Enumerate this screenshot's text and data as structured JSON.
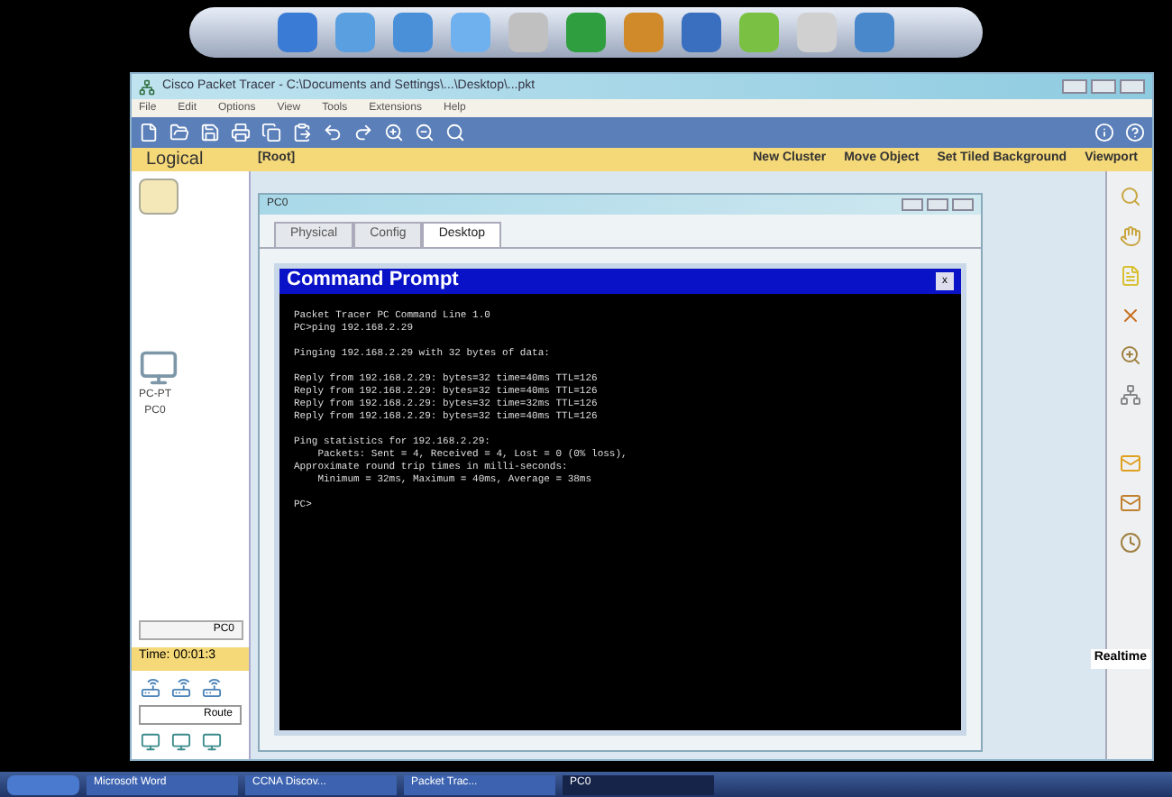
{
  "window": {
    "title": "Cisco Packet Tracer - C:\\Documents and Settings\\...\\Desktop\\...pkt"
  },
  "menu": [
    "File",
    "Edit",
    "Options",
    "View",
    "Tools",
    "Extensions",
    "Help"
  ],
  "workspace_bar": {
    "mode": "Logical",
    "path": "[Root]",
    "actions": [
      "New Cluster",
      "Move Object",
      "Set Tiled Background",
      "Viewport"
    ]
  },
  "devices": [
    {
      "label": "PC-PT\nPC0"
    }
  ],
  "device_name_field": {
    "value": "PC0"
  },
  "time": "Time: 00:01:3",
  "device_category": "Route",
  "realtime": {
    "label": "Realtime"
  },
  "pc_window": {
    "title": "PC0",
    "tabs": [
      {
        "label": "Physical",
        "selected": false
      },
      {
        "label": "Config",
        "selected": false
      },
      {
        "label": "Desktop",
        "selected": true
      }
    ]
  },
  "command_prompt": {
    "title": "Command Prompt",
    "close": "x",
    "blocks": [
      [
        "Packet Tracer PC Command Line 1.0",
        "PC>ping 192.168.2.29"
      ],
      [
        "Pinging 192.168.2.29 with 32 bytes of data:"
      ],
      [
        "Reply from 192.168.2.29: bytes=32 time=40ms TTL=126",
        "Reply from 192.168.2.29: bytes=32 time=40ms TTL=126",
        "Reply from 192.168.2.29: bytes=32 time=32ms TTL=126",
        "Reply from 192.168.2.29: bytes=32 time=40ms TTL=126"
      ],
      [
        "Ping statistics for 192.168.2.29:",
        "    Packets: Sent = 4, Received = 4, Lost = 0 (0% loss),",
        "Approximate round trip times in milli-seconds:",
        "    Minimum = 32ms, Maximum = 40ms, Average = 38ms"
      ],
      [
        "PC>"
      ]
    ]
  },
  "taskbar": {
    "items": [
      {
        "label": "Microsoft Word",
        "selected": false
      },
      {
        "label": "CCNA Discov...",
        "selected": false
      },
      {
        "label": "Packet Trac...",
        "selected": false
      },
      {
        "label": "PC0",
        "selected": true
      }
    ]
  }
}
